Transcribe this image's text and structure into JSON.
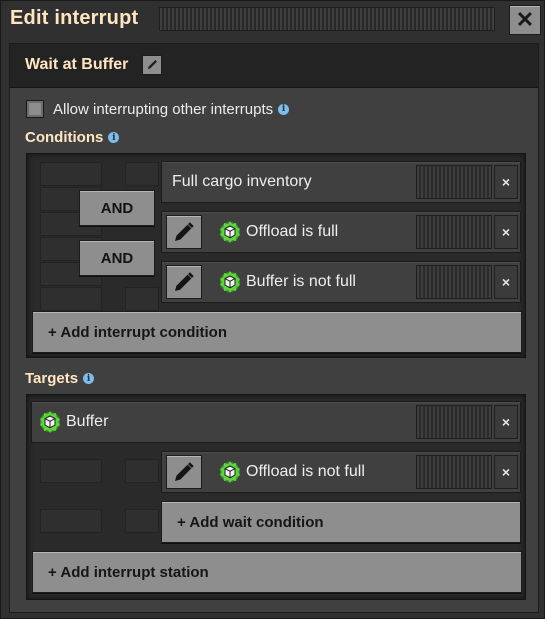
{
  "window": {
    "title": "Edit interrupt",
    "close_symbol": "✕"
  },
  "interrupt": {
    "name": "Wait at Buffer",
    "allow_interrupting_label": "Allow interrupting other interrupts",
    "allow_interrupting_checked": false
  },
  "conditions": {
    "title": "Conditions",
    "items": [
      {
        "label": "Full cargo inventory",
        "editable": false,
        "icon": null
      },
      {
        "connector": "AND",
        "label": "Offload is full",
        "editable": true,
        "icon": "signal-cube-icon"
      },
      {
        "connector": "AND",
        "label": "Buffer is not full",
        "editable": true,
        "icon": "signal-cube-icon"
      }
    ],
    "add_label": "+ Add interrupt condition"
  },
  "targets": {
    "title": "Targets",
    "station": {
      "label": "Buffer",
      "icon": "signal-cube-icon"
    },
    "wait_conditions": [
      {
        "label": "Offload is not full",
        "editable": true,
        "icon": "signal-cube-icon"
      }
    ],
    "add_wait_label": "+ Add wait condition",
    "add_station_label": "+ Add interrupt station"
  },
  "remove_symbol": "×",
  "colors": {
    "title_text": "#ffe6c0",
    "button_grey": "#8e8e8e",
    "info_blue": "#7dbde7",
    "signal_green": "#5bd63a"
  }
}
